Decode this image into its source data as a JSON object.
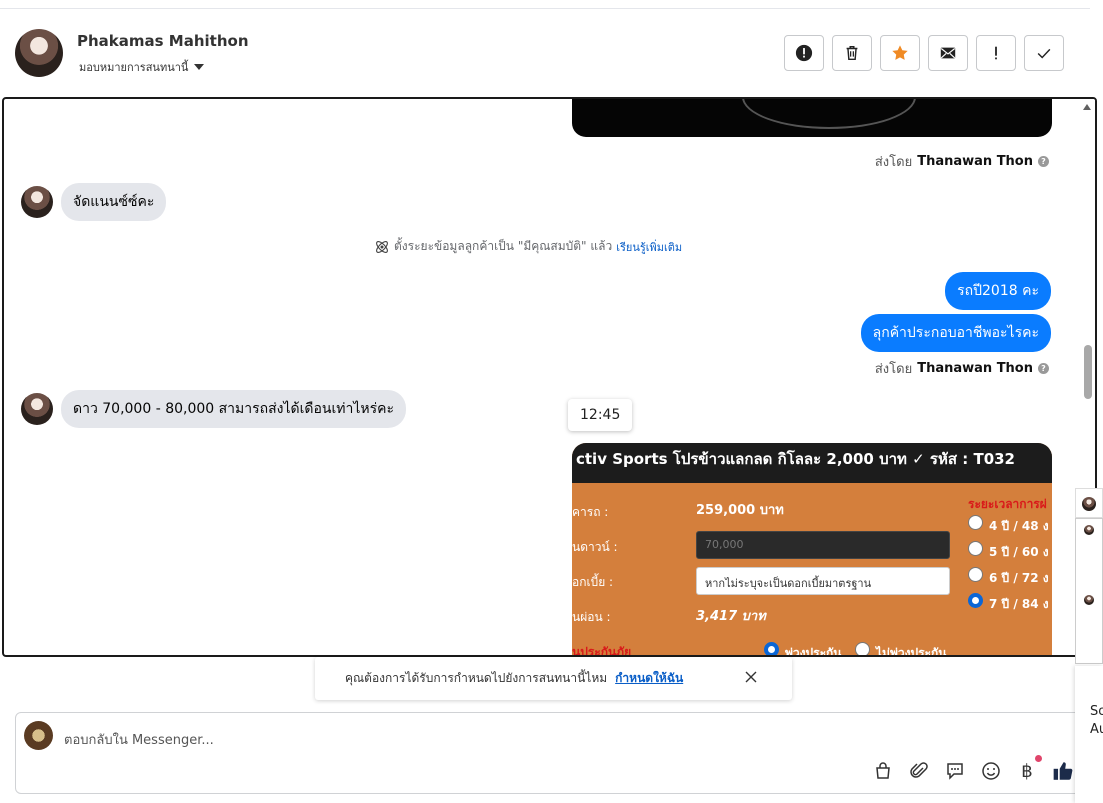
{
  "header": {
    "contact_name": "Phakamas Mahithon",
    "assign_label": "มอบหมายการสนทนานี้"
  },
  "actions": [
    "alert-icon",
    "trash-icon",
    "star-icon",
    "envelope-icon",
    "exclamation-icon",
    "check-icon"
  ],
  "colors": {
    "accent": "#0a7cff",
    "star": "#f08a24",
    "bubble_in": "#e4e6eb"
  },
  "chat": {
    "sent_by_prefix": "ส่งโดย",
    "sent_by_name": "Thanawan Thon",
    "msg_in_1": "จัดแนนซ์ซ์คะ",
    "system_note": "ตั้งระยะข้อมูลลูกค้าเป็น \"มีคุณสมบัติ\" แล้ว",
    "learn_more": "เรียนรู้เพิ่มเติม",
    "msg_out_1": "รถปี2018 คะ",
    "msg_out_2": "ลุกค้าประกอบอาชีพอะไรคะ",
    "msg_in_2": "ดาว 70,000 - 80,000 สามารถส่งได้เดือนเท่าไหร่คะ",
    "timestamp": "12:45",
    "promo": {
      "title": "ctiv Sports โปรข้าวแลกลด กิโลละ 2,000 บาท ✓ รหัส : T032",
      "label_price": "คารถ :",
      "price": "259,000 บาท",
      "label_down": "นดาวน์ :",
      "down_placeholder": "70,000",
      "label_interest": "อกเบี้ย :",
      "interest_placeholder": "หากไม่ระบุจะเป็นดอกเบี้ยมาตรฐาน",
      "label_monthly": "นผ่อน :",
      "monthly": "3,417 บาท",
      "term_title": "ระยะเวลาการผ่",
      "terms": [
        "4 ปี / 48 ง",
        "5 ปี / 60 ง",
        "6 ปี / 72 ง",
        "7 ปี / 84 ง"
      ],
      "selected_term": 3,
      "insurance_label": "นประกันภัย",
      "ins_option_1": "พ่วงประกัน",
      "ins_option_2": "ไม่พ่วงประกัน"
    }
  },
  "banner": {
    "question": "คุณต้องการได้รับการกำหนดไปยังการสนทนานี้ไหม",
    "assign_me": "กำหนดให้ฉัน"
  },
  "composer": {
    "placeholder": "ตอบกลับใน Messenger...",
    "currency_symbol": "฿"
  },
  "right_peek": {
    "line1": "So",
    "line2": "Au"
  }
}
